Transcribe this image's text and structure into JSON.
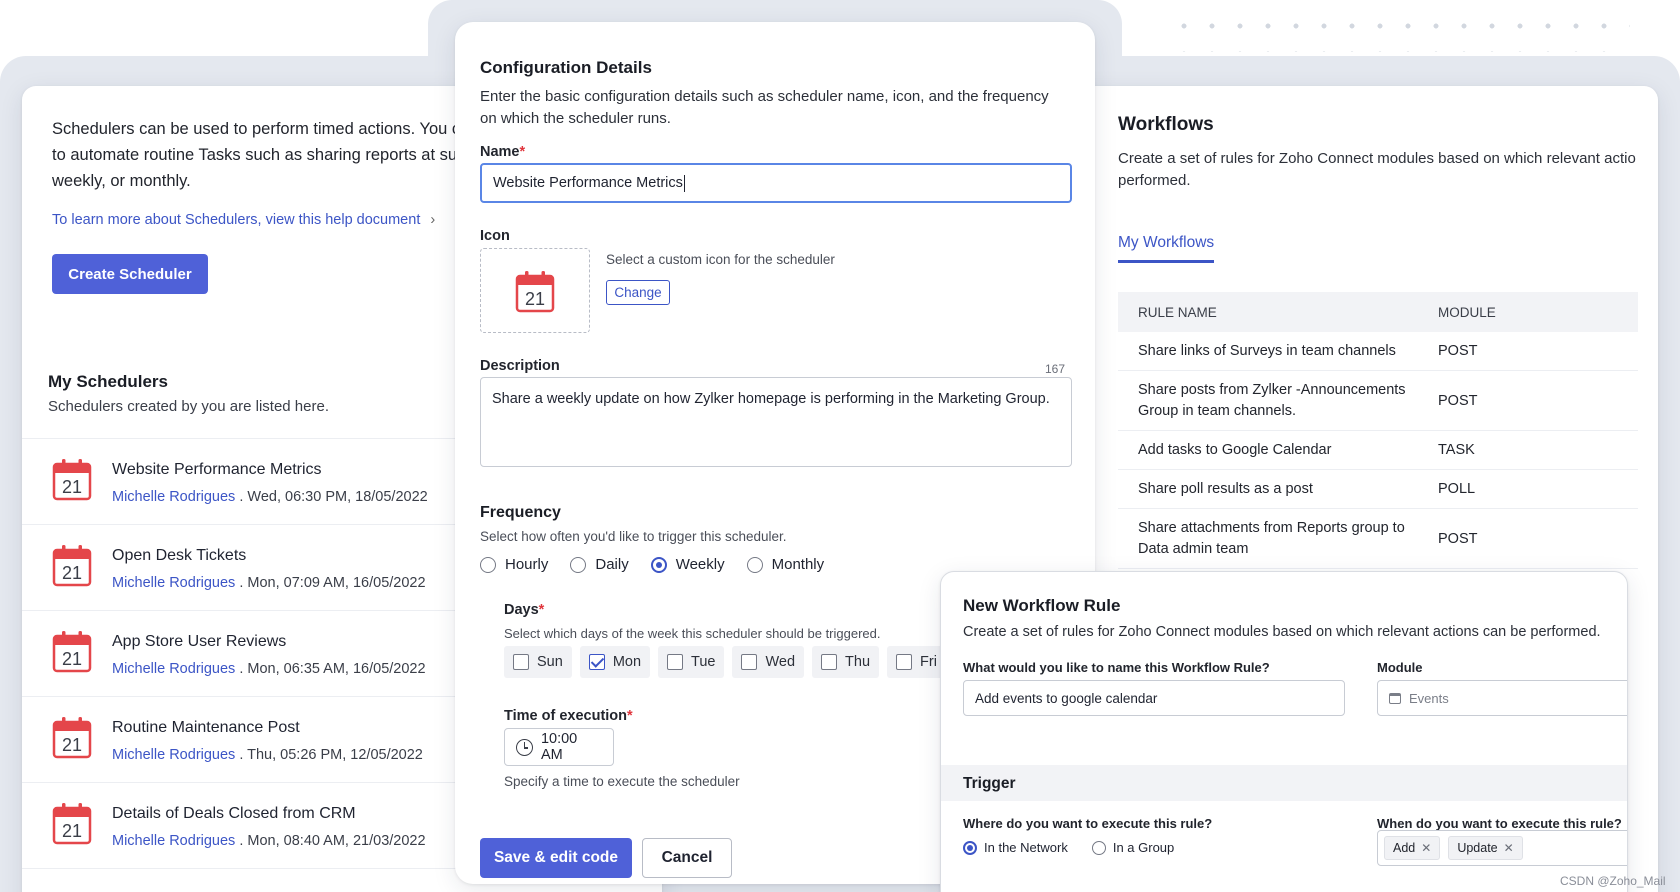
{
  "left_panel": {
    "intro": "Schedulers can be used to perform timed actions. You ca to automate routine Tasks such as sharing reports at suit weekly, or monthly.",
    "help_link": "To learn more about Schedulers, view this help document",
    "create_button": "Create Scheduler",
    "my_title": "My Schedulers",
    "my_subtitle": "Schedulers created by you are listed here.",
    "schedulers": [
      {
        "title": "Website Performance Metrics",
        "author": "Michelle Rodrigues",
        "meta": " . Wed, 06:30 PM, 18/05/2022",
        "icon": "calendar-icon"
      },
      {
        "title": "Open Desk Tickets",
        "author": "Michelle Rodrigues",
        "meta": " . Mon, 07:09 AM, 16/05/2022",
        "icon": "calendar-icon"
      },
      {
        "title": "App Store User Reviews",
        "author": "Michelle Rodrigues",
        "meta": " . Mon, 06:35 AM, 16/05/2022",
        "icon": "calendar-icon"
      },
      {
        "title": "Routine Maintenance Post",
        "author": "Michelle Rodrigues",
        "meta": " . Thu, 05:26 PM, 12/05/2022",
        "icon": "calendar-icon"
      },
      {
        "title": "Details of Deals Closed from CRM",
        "author": "Michelle Rodrigues",
        "meta": " . Mon, 08:40 AM, 21/03/2022",
        "icon": "calendar-icon"
      }
    ],
    "calendar_day": "21"
  },
  "config": {
    "title": "Configuration Details",
    "description": "Enter the basic configuration details such as scheduler name, icon, and the frequency on which the scheduler runs.",
    "name_label": "Name",
    "required_mark": "*",
    "name_value": "Website Performance Metrics",
    "icon_label": "Icon",
    "icon_hint": "Select a custom icon for the scheduler",
    "change_button": "Change",
    "description_label": "Description",
    "description_count": "167",
    "description_value": "Share a weekly update on how Zylker homepage is performing in the Marketing Group.",
    "frequency_title": "Frequency",
    "frequency_subtitle": "Select how often you'd like to trigger this scheduler.",
    "frequency_options": [
      {
        "label": "Hourly",
        "selected": false
      },
      {
        "label": "Daily",
        "selected": false
      },
      {
        "label": "Weekly",
        "selected": true
      },
      {
        "label": "Monthly",
        "selected": false
      }
    ],
    "days_label": "Days",
    "days_subtitle": "Select which days of the week this scheduler should be triggered.",
    "days": [
      {
        "label": "Sun",
        "checked": false
      },
      {
        "label": "Mon",
        "checked": true
      },
      {
        "label": "Tue",
        "checked": false
      },
      {
        "label": "Wed",
        "checked": false
      },
      {
        "label": "Thu",
        "checked": false
      },
      {
        "label": "Fri",
        "checked": false
      }
    ],
    "time_label": "Time of execution",
    "time_value": "10:00 AM",
    "time_hint": "Specify a time to execute the scheduler",
    "save_button": "Save & edit code",
    "cancel_button": "Cancel"
  },
  "workflows": {
    "title": "Workflows",
    "description": "Create a set of rules for Zoho Connect modules based on which relevant actio performed.",
    "tab": "My Workflows",
    "columns": [
      "RULE NAME",
      "MODULE"
    ],
    "rows": [
      {
        "name": "Share links of Surveys in team channels",
        "module": "POST"
      },
      {
        "name": "Share posts from Zylker -Announcements Group in team channels.",
        "module": "POST"
      },
      {
        "name": "Add tasks to Google Calendar",
        "module": "TASK"
      },
      {
        "name": "Share poll results as a post",
        "module": "POLL"
      },
      {
        "name": "Share attachments from Reports group to Data admin team",
        "module": "POST"
      }
    ]
  },
  "new_rule": {
    "title": "New Workflow Rule",
    "description": "Create a set of rules for Zoho Connect modules based on which relevant actions can be performed.",
    "name_label": "What would you like to name this Workflow Rule?",
    "name_value": "Add events to google calendar",
    "module_label": "Module",
    "module_placeholder": "Events",
    "trigger_title": "Trigger",
    "where_label": "Where do you want to execute this rule?",
    "where_options": [
      {
        "label": "In the Network",
        "selected": true
      },
      {
        "label": "In a Group",
        "selected": false
      }
    ],
    "when_label": "When do you want to execute this rule?",
    "when_tags": [
      "Add",
      "Update"
    ],
    "tag_remove": "✕"
  },
  "watermark": "CSDN @Zoho_Mail",
  "colors": {
    "accent": "#4f61d8",
    "link": "#3c55c6",
    "calendar": "#e4464a"
  }
}
